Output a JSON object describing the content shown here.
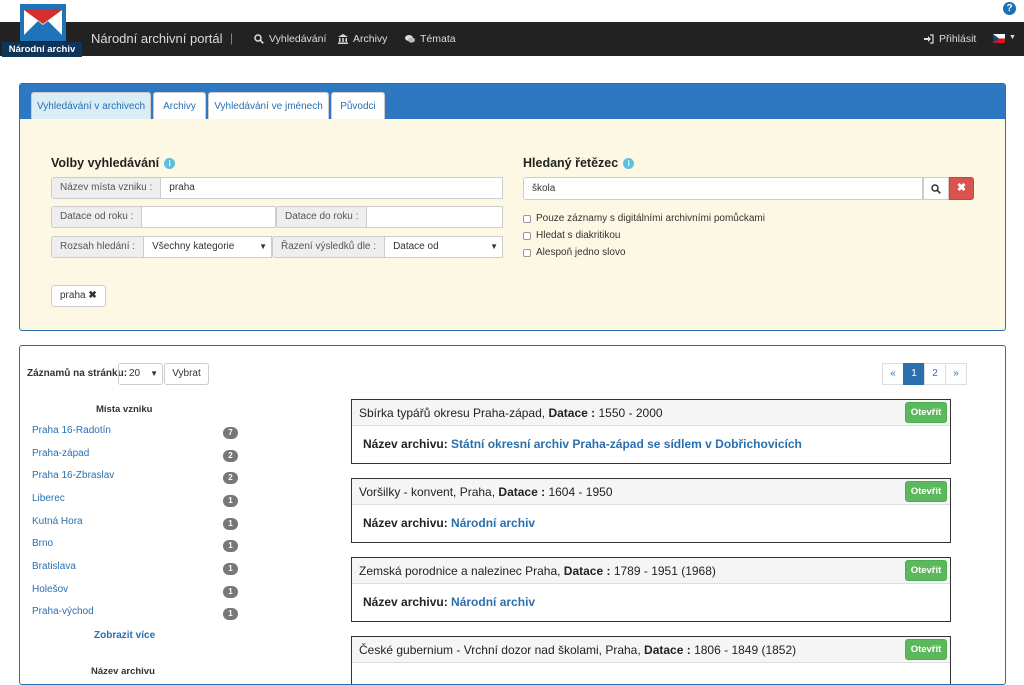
{
  "header": {
    "logo_text": "Národní archiv",
    "brand": "Národní archivní portál",
    "separator": "|",
    "nav": [
      {
        "label": "Vyhledávání",
        "icon": "search-icon"
      },
      {
        "label": "Archivy",
        "icon": "institution-icon"
      },
      {
        "label": "Témata",
        "icon": "comments-icon"
      }
    ],
    "login": "Přihlásit",
    "help": "?"
  },
  "search": {
    "tabs": [
      {
        "label": "Vyhledávání v archivech",
        "active": true
      },
      {
        "label": "Archivy",
        "active": false
      },
      {
        "label": "Vyhledávání ve jménech",
        "active": false
      },
      {
        "label": "Původci",
        "active": false
      }
    ],
    "options_title": "Volby vyhledávání",
    "place_label": "Název místa vzniku :",
    "place_value": "praha",
    "date_from_label": "Datace od roku :",
    "date_from_value": "",
    "date_to_label": "Datace do roku :",
    "date_to_value": "",
    "scope_label": "Rozsah hledání :",
    "scope_value": "Všechny kategorie",
    "sort_label": "Řazení výsledků dle :",
    "sort_value": "Datace od",
    "chip": "praha",
    "string_title": "Hledaný řetězec",
    "string_value": "škola",
    "checkboxes": [
      "Pouze záznamy s digitálními archivními pomůckami",
      "Hledat s diakritikou",
      "Alespoň jedno slovo"
    ]
  },
  "results": {
    "per_page_label": "Záznamů na stránku:",
    "per_page_value": "20",
    "select_button": "Vybrat",
    "pager": [
      "«",
      "1",
      "2",
      "»"
    ],
    "facet_places_title": "Místa vzniku",
    "facets": [
      {
        "label": "Praha 16-Radotín",
        "count": "7"
      },
      {
        "label": "Praha-západ",
        "count": "2"
      },
      {
        "label": "Praha 16-Zbraslav",
        "count": "2"
      },
      {
        "label": "Liberec",
        "count": "1"
      },
      {
        "label": "Kutná Hora",
        "count": "1"
      },
      {
        "label": "Brno",
        "count": "1"
      },
      {
        "label": "Bratislava",
        "count": "1"
      },
      {
        "label": "Holešov",
        "count": "1"
      },
      {
        "label": "Praha-východ",
        "count": "1"
      }
    ],
    "show_more": "Zobrazit více",
    "facet_archive_title": "Název archivu",
    "datace_label": "Datace :",
    "archive_label": "Název archivu:",
    "open_button": "Otevřít",
    "items": [
      {
        "title": "Sbírka typářů okresu Praha-západ,",
        "datace": "1550 - 2000",
        "archive": "Státní okresní archiv Praha-západ se sídlem v Dobřichovicích"
      },
      {
        "title": "Voršilky - konvent, Praha,",
        "datace": "1604 - 1950",
        "archive": "Národní archiv"
      },
      {
        "title": "Zemská porodnice a nalezinec Praha,",
        "datace": "1789 - 1951 (1968)",
        "archive": "Národní archiv"
      },
      {
        "title": "České gubernium - Vrchní dozor nad školami, Praha,",
        "datace": "1806 - 1849 (1852)",
        "archive": ""
      }
    ]
  }
}
